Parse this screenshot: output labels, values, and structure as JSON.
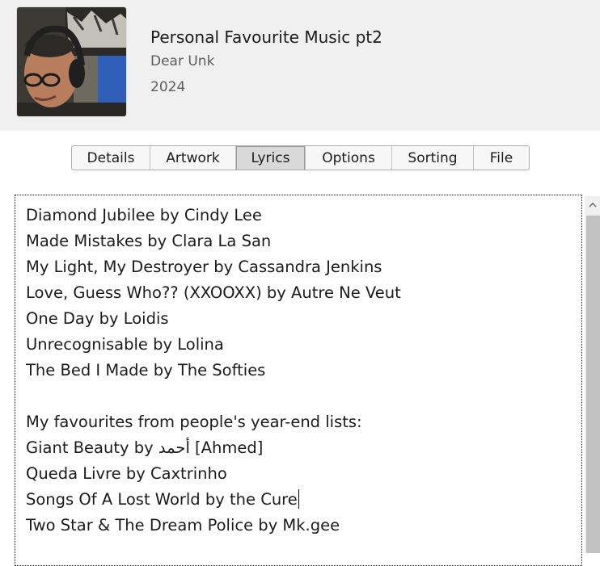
{
  "album": {
    "title": "Personal Favourite Music pt2",
    "artist": "Dear Unk",
    "year": "2024"
  },
  "tabs": [
    {
      "label": "Details",
      "active": false
    },
    {
      "label": "Artwork",
      "active": false
    },
    {
      "label": "Lyrics",
      "active": true
    },
    {
      "label": "Options",
      "active": false
    },
    {
      "label": "Sorting",
      "active": false
    },
    {
      "label": "File",
      "active": false
    }
  ],
  "lyrics": {
    "lines": [
      "Diamond Jubilee by Cindy Lee",
      "Made Mistakes by Clara La San",
      "My Light, My Destroyer by Cassandra Jenkins",
      "Love, Guess Who?? (XXOOXX) by Autre Ne Veut",
      "One Day by Loidis",
      "Unrecognisable by Lolina",
      "The Bed I Made by The Softies",
      "",
      "My favourites from people's year-end lists:",
      "Giant Beauty by أحمد [Ahmed]",
      "Queda Livre by Caxtrinho",
      "Songs Of A Lost World by the Cure",
      "Two Star & The Dream Police by Mk.gee"
    ]
  },
  "icons": {
    "scroll_up": "chevron-up-icon"
  },
  "colors": {
    "header_bg": "#f0f0f0",
    "active_tab_bg": "#d9d9d9",
    "secondary_text": "#5c5c5c"
  }
}
